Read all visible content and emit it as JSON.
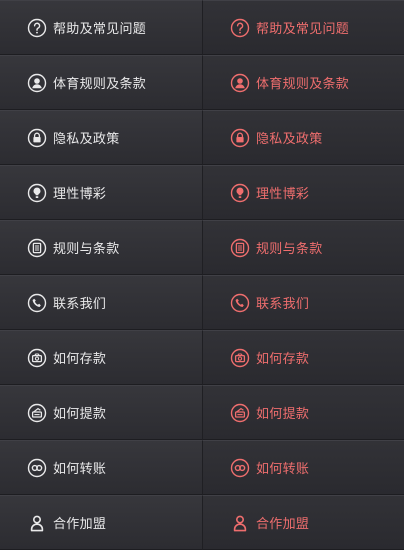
{
  "menu": {
    "items": [
      {
        "label": "帮助及常见问题",
        "icon": "question-icon"
      },
      {
        "label": "体育规则及条款",
        "icon": "user-icon"
      },
      {
        "label": "隐私及政策",
        "icon": "lock-icon"
      },
      {
        "label": "理性博彩",
        "icon": "bulb-icon"
      },
      {
        "label": "规则与条款",
        "icon": "document-icon"
      },
      {
        "label": "联系我们",
        "icon": "phone-icon"
      },
      {
        "label": "如何存款",
        "icon": "deposit-icon"
      },
      {
        "label": "如何提款",
        "icon": "withdraw-icon"
      },
      {
        "label": "如何转账",
        "icon": "transfer-icon"
      },
      {
        "label": "合作加盟",
        "icon": "partner-icon"
      }
    ],
    "colors": {
      "normal": "#e9e9ea",
      "active": "#ef6e6e",
      "background": "#2a2a2e"
    }
  }
}
